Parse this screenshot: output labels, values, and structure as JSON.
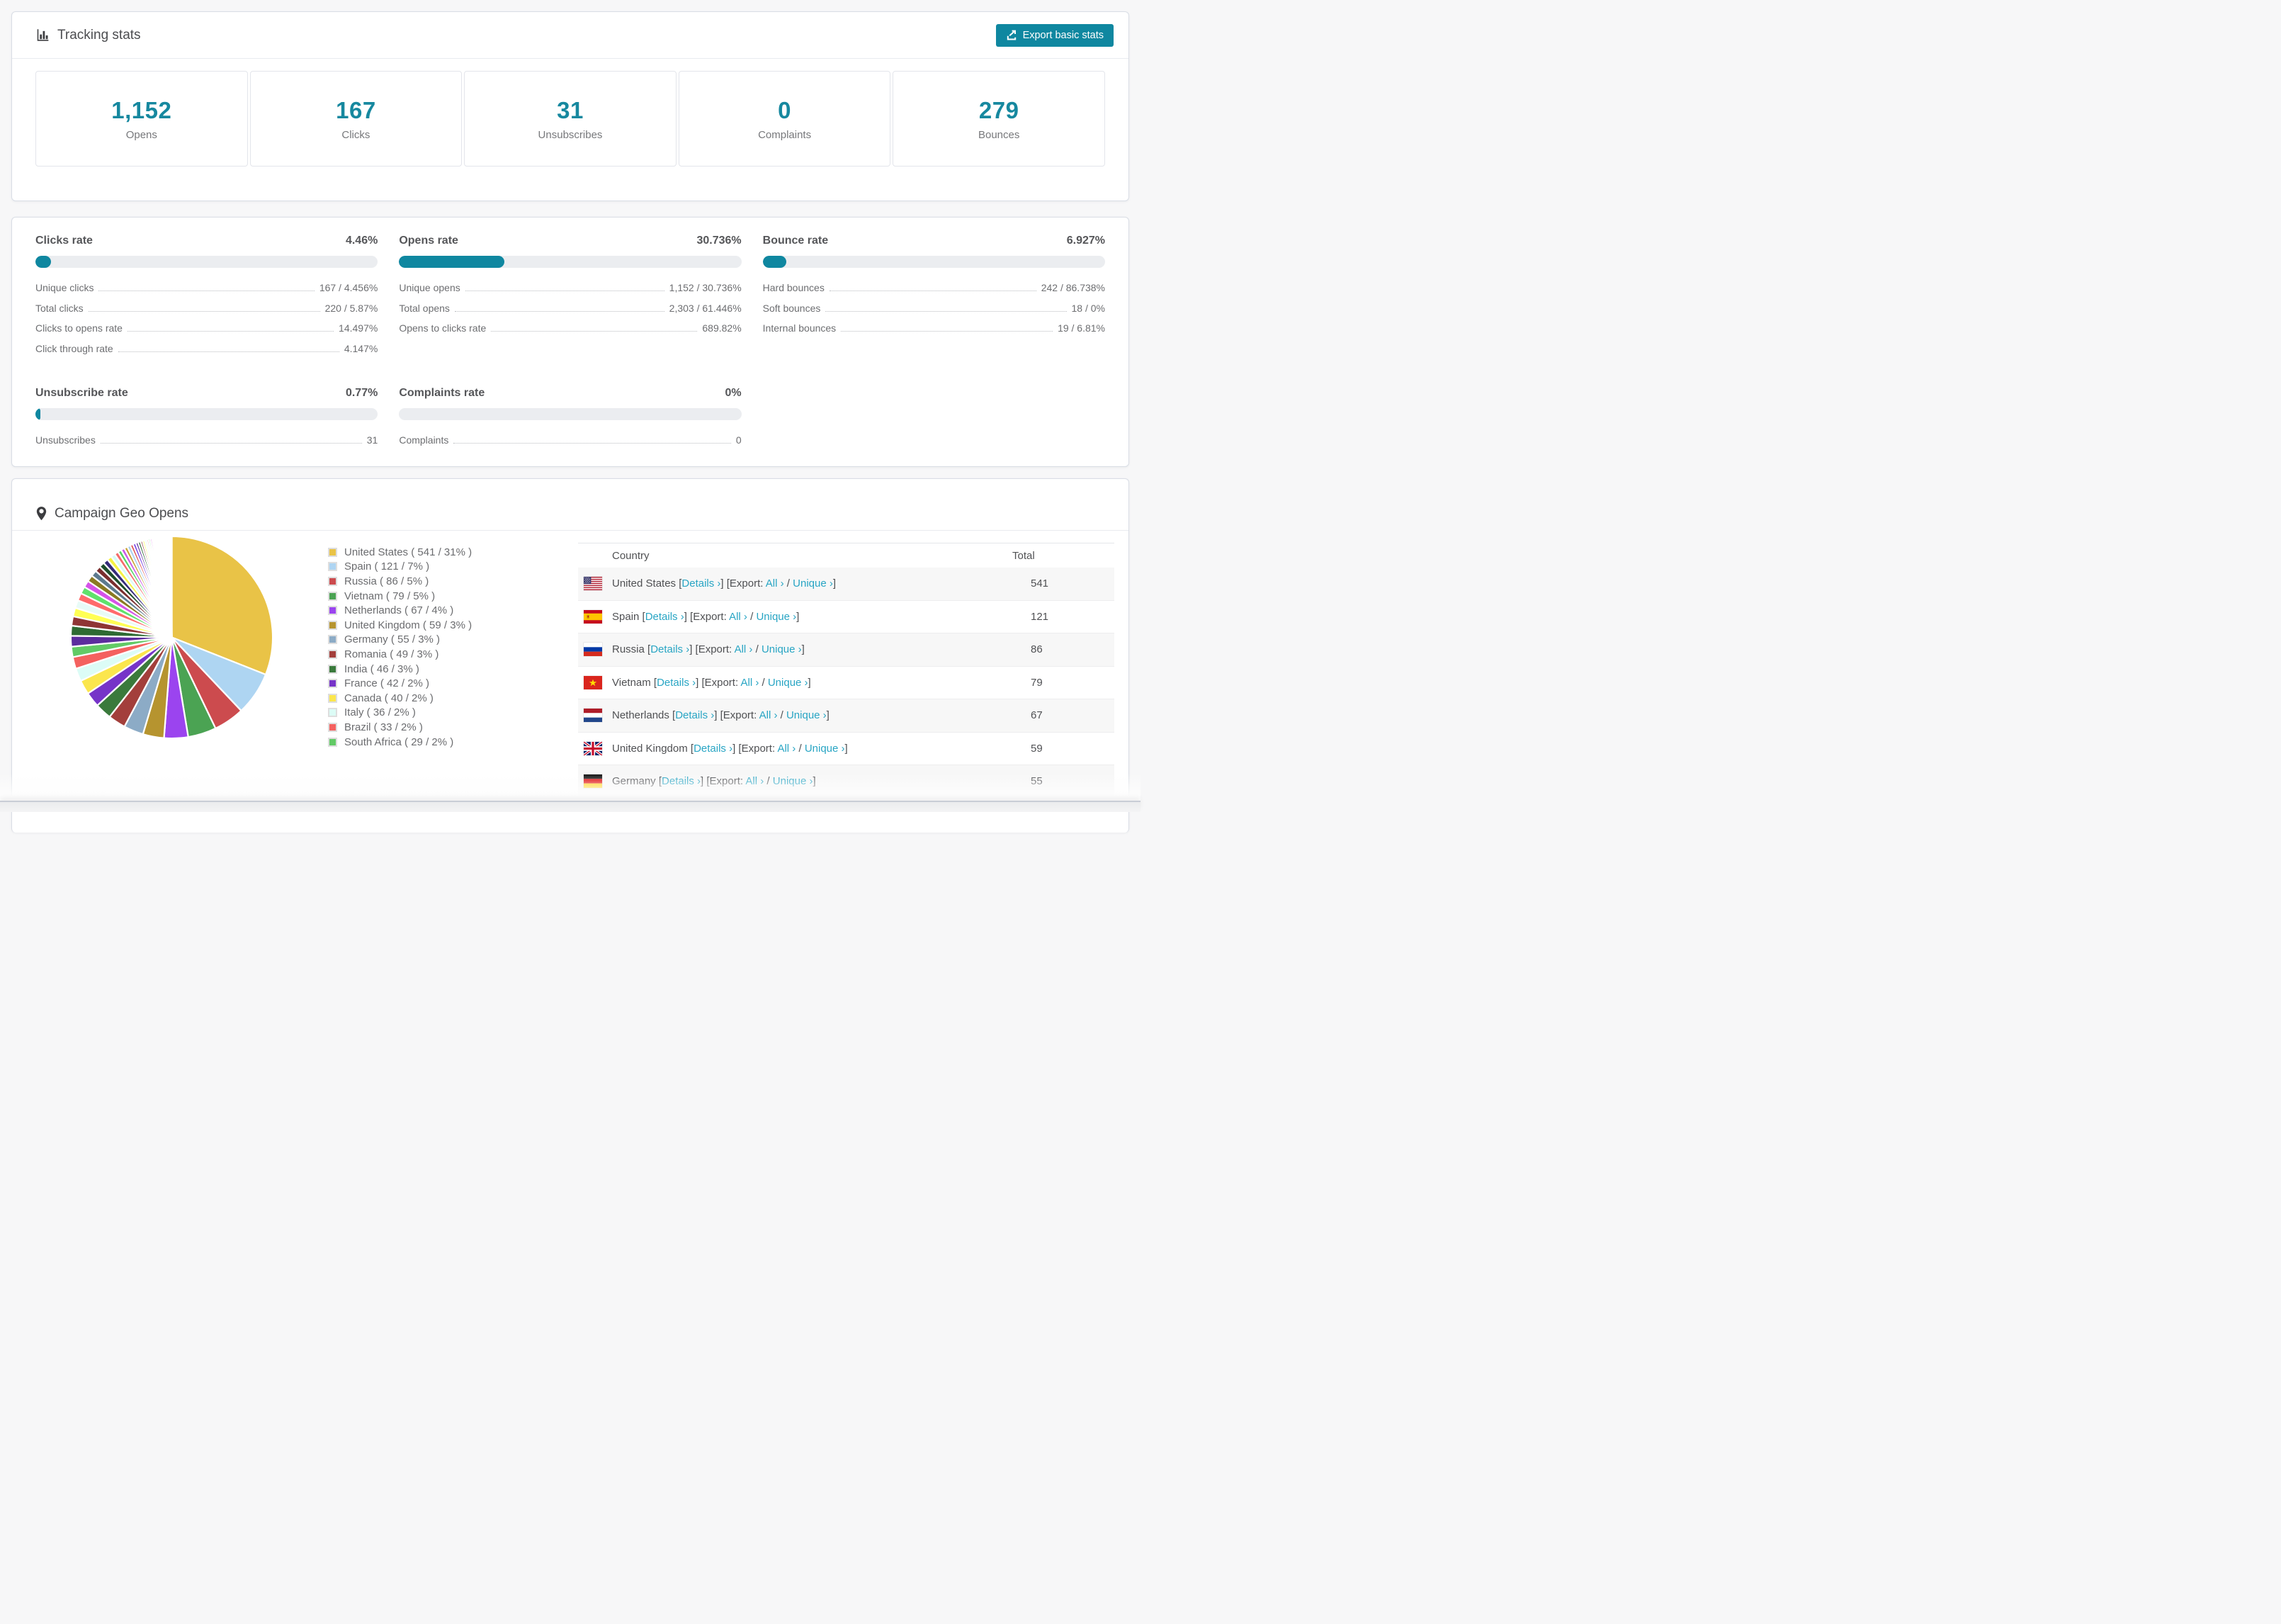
{
  "theme": {
    "accent": "#0f87a0",
    "stat_number": "#16889f",
    "link": "#28a5c4",
    "bar_track": "#ebedf0"
  },
  "tracking": {
    "title": "Tracking stats",
    "export_button": "Export basic stats",
    "boxes": [
      {
        "value": "1,152",
        "label": "Opens"
      },
      {
        "value": "167",
        "label": "Clicks"
      },
      {
        "value": "31",
        "label": "Unsubscribes"
      },
      {
        "value": "0",
        "label": "Complaints"
      },
      {
        "value": "279",
        "label": "Bounces"
      }
    ]
  },
  "rates": {
    "sections": [
      {
        "title": "Clicks rate",
        "value": "4.46%",
        "bar_percent": 4.46,
        "rows": [
          {
            "label": "Unique clicks",
            "value": "167 / 4.456%"
          },
          {
            "label": "Total clicks",
            "value": "220 / 5.87%"
          },
          {
            "label": "Clicks to opens rate",
            "value": "14.497%"
          },
          {
            "label": "Click through rate",
            "value": "4.147%"
          }
        ]
      },
      {
        "title": "Opens rate",
        "value": "30.736%",
        "bar_percent": 30.736,
        "rows": [
          {
            "label": "Unique opens",
            "value": "1,152 / 30.736%"
          },
          {
            "label": "Total opens",
            "value": "2,303 / 61.446%"
          },
          {
            "label": "Opens to clicks rate",
            "value": "689.82%"
          }
        ]
      },
      {
        "title": "Bounce rate",
        "value": "6.927%",
        "bar_percent": 6.927,
        "rows": [
          {
            "label": "Hard bounces",
            "value": "242 / 86.738%"
          },
          {
            "label": "Soft bounces",
            "value": "18 / 0%"
          },
          {
            "label": "Internal bounces",
            "value": "19 / 6.81%"
          }
        ]
      },
      {
        "title": "Unsubscribe rate",
        "value": "0.77%",
        "bar_percent": 0.77,
        "rows": [
          {
            "label": "Unsubscribes",
            "value": "31"
          }
        ]
      },
      {
        "title": "Complaints rate",
        "value": "0%",
        "bar_percent": 0,
        "rows": [
          {
            "label": "Complaints",
            "value": "0"
          }
        ]
      }
    ]
  },
  "geo": {
    "title": "Campaign Geo Opens",
    "table": {
      "columns": [
        "Country",
        "Total"
      ],
      "details_label": "Details ›",
      "export_label": "Export:",
      "all_label": "All ›",
      "unique_label": "Unique ›",
      "rows": [
        {
          "country": "United States",
          "flag": "us",
          "total": "541"
        },
        {
          "country": "Spain",
          "flag": "es",
          "total": "121"
        },
        {
          "country": "Russia",
          "flag": "ru",
          "total": "86"
        },
        {
          "country": "Vietnam",
          "flag": "vn",
          "total": "79"
        },
        {
          "country": "Netherlands",
          "flag": "nl",
          "total": "67"
        },
        {
          "country": "United Kingdom",
          "flag": "gb",
          "total": "59"
        },
        {
          "country": "Germany",
          "flag": "de",
          "total": "55"
        }
      ]
    },
    "chart_data": {
      "type": "pie",
      "title": "Campaign Geo Opens",
      "start_angle_deg": -90,
      "direction": "clockwise",
      "legend_position": "right",
      "series": [
        {
          "name": "United States",
          "value": 541,
          "pct": "31%",
          "color": "#e9c347"
        },
        {
          "name": "Spain",
          "value": 121,
          "pct": "7%",
          "color": "#aed5f2"
        },
        {
          "name": "Russia",
          "value": 86,
          "pct": "5%",
          "color": "#cc4b4e"
        },
        {
          "name": "Vietnam",
          "value": 79,
          "pct": "5%",
          "color": "#4ba353"
        },
        {
          "name": "Netherlands",
          "value": 67,
          "pct": "4%",
          "color": "#9b44ef"
        },
        {
          "name": "United Kingdom",
          "value": 59,
          "pct": "3%",
          "color": "#b6942f"
        },
        {
          "name": "Germany",
          "value": 55,
          "pct": "3%",
          "color": "#8cabc6"
        },
        {
          "name": "Romania",
          "value": 49,
          "pct": "3%",
          "color": "#a33f3b"
        },
        {
          "name": "India",
          "value": 46,
          "pct": "3%",
          "color": "#3a7a3c"
        },
        {
          "name": "France",
          "value": 42,
          "pct": "2%",
          "color": "#7634c8"
        },
        {
          "name": "Canada",
          "value": 40,
          "pct": "2%",
          "color": "#fbe64d"
        },
        {
          "name": "Italy",
          "value": 36,
          "pct": "2%",
          "color": "#dcfcf6"
        },
        {
          "name": "Brazil",
          "value": 33,
          "pct": "2%",
          "color": "#f4615f"
        },
        {
          "name": "South Africa",
          "value": 29,
          "pct": "2%",
          "color": "#62ca66"
        }
      ],
      "others_values": [
        30,
        28,
        26,
        24,
        22,
        21,
        20,
        19,
        18,
        17,
        16,
        15,
        14,
        13,
        12,
        11,
        10,
        10,
        9,
        9,
        8,
        8,
        7,
        7,
        6,
        6,
        6,
        5,
        5,
        5,
        4,
        4,
        4,
        4,
        3,
        3,
        3,
        3,
        3,
        2,
        2,
        2,
        2,
        2,
        2,
        2,
        1,
        1,
        1,
        1,
        1,
        1,
        1,
        1,
        1,
        1
      ],
      "others_colors": [
        "#5c2d9e",
        "#2e6b33",
        "#8f3535",
        "#ffff55",
        "#e8fbf7",
        "#ff6b6b",
        "#5fe26b",
        "#d553e8",
        "#8a7a22",
        "#5c7a8e",
        "#7a2e2e",
        "#1e4d2b",
        "#352a7a",
        "#f5f243",
        "#d5fbf7",
        "#f46b6b",
        "#55d667",
        "#cb58e8",
        "#c8a02e",
        "#a8d0f0",
        "#e05050",
        "#7a44e8"
      ]
    },
    "legend_item_format": "{name} ( {value} / {pct} )"
  }
}
